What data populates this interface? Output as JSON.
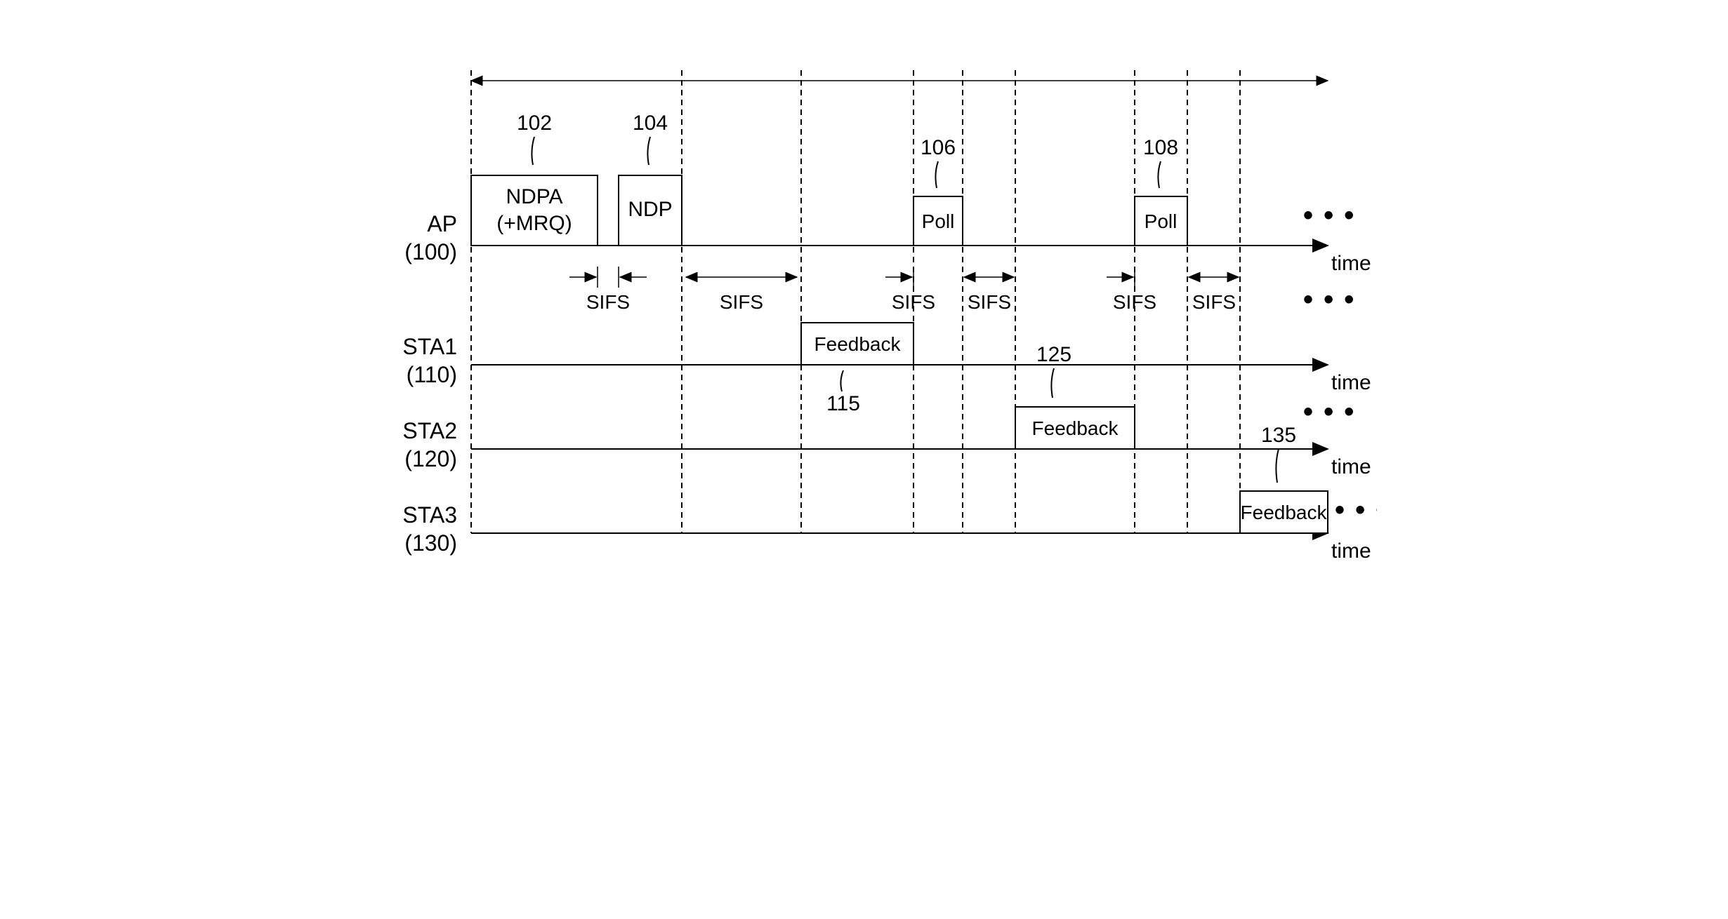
{
  "lanes": {
    "ap": {
      "label1": "AP",
      "label2": "(100)",
      "axis": "time"
    },
    "sta1": {
      "label1": "STA1",
      "label2": "(110)",
      "axis": "time"
    },
    "sta2": {
      "label1": "STA2",
      "label2": "(120)",
      "axis": "time"
    },
    "sta3": {
      "label1": "STA3",
      "label2": "(130)",
      "axis": "time"
    }
  },
  "blocks": {
    "ndpa": {
      "line1": "NDPA",
      "line2": "(+MRQ)",
      "ref": "102"
    },
    "ndp": {
      "label": "NDP",
      "ref": "104"
    },
    "poll1": {
      "label": "Poll",
      "ref": "106"
    },
    "poll2": {
      "label": "Poll",
      "ref": "108"
    },
    "fb1": {
      "label": "Feedback",
      "ref": "115"
    },
    "fb2": {
      "label": "Feedback",
      "ref": "125"
    },
    "fb3": {
      "label": "Feedback",
      "ref": "135"
    }
  },
  "gaps": {
    "sifs1": "SIFS",
    "sifs2": "SIFS",
    "sifs3": "SIFS",
    "sifs4": "SIFS",
    "sifs5": "SIFS",
    "sifs6": "SIFS"
  },
  "ellipsis": "• • •"
}
